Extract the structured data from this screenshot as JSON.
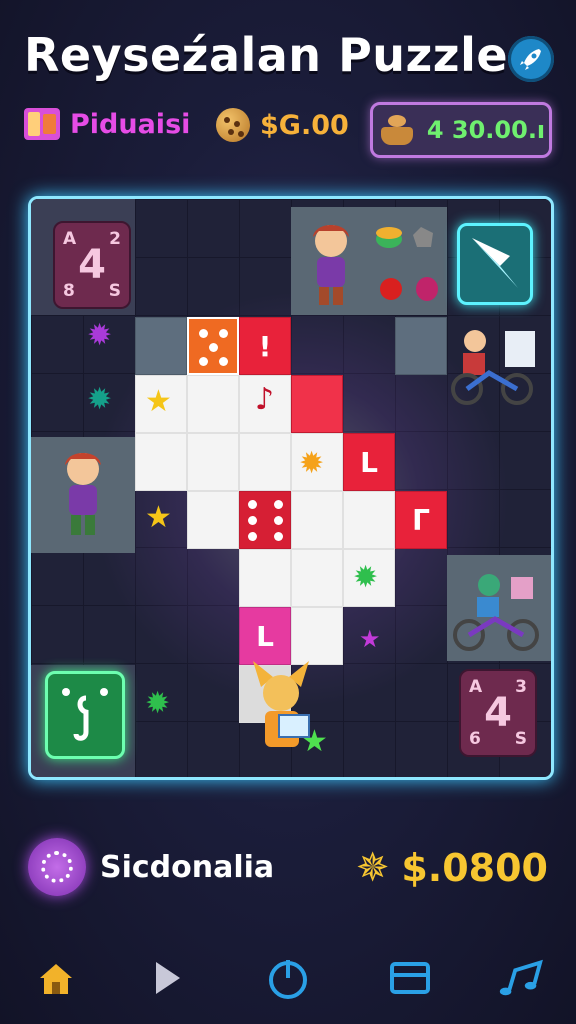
{
  "header": {
    "title": "Reyseźalan Puzzle",
    "settings_icon": "rocket-icon"
  },
  "stats": {
    "player_label": "Piduaisi",
    "currency_value": "$G.00",
    "coins_value": "4 30.00.ı"
  },
  "board": {
    "tiles": [
      {
        "type": "text",
        "text": "!"
      },
      {
        "type": "text",
        "text": "L"
      },
      {
        "type": "text",
        "text": "Γ"
      },
      {
        "type": "text",
        "text": "L"
      }
    ],
    "number_cards": [
      {
        "center": "4",
        "tl": "A",
        "tr": "2",
        "bl": "8",
        "br": "S"
      },
      {
        "center": "4",
        "tl": "A",
        "tr": "3",
        "bl": "6",
        "br": "S"
      }
    ]
  },
  "footer": {
    "player_name": "Sicdonalia",
    "score": "$.0800"
  },
  "nav": {
    "items": [
      "home-icon",
      "play-icon",
      "power-icon",
      "card-icon",
      "music-icon"
    ]
  },
  "colors": {
    "accent_cyan": "#8fe8ff",
    "accent_pink": "#e64ce6",
    "gold": "#f7c631",
    "green": "#6ff06f"
  }
}
